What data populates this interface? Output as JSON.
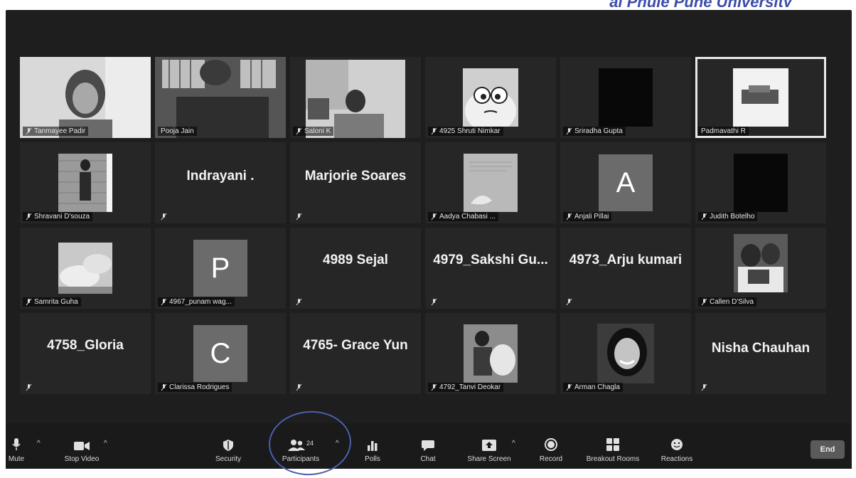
{
  "banner_text": "ai Phule Pune University",
  "participants": [
    {
      "name": "Tanmayee Padir"
    },
    {
      "name": "Pooja Jain"
    },
    {
      "name": "Saloni K"
    },
    {
      "name": "4925 Shruti Nimkar"
    },
    {
      "name": "Sriradha Gupta"
    },
    {
      "name": "Padmavathi R"
    },
    {
      "name": "Shravani D'souza"
    },
    {
      "name": "Indrayani ."
    },
    {
      "name": "Marjorie Soares"
    },
    {
      "name": "Aadya Chabasi ..."
    },
    {
      "name": "Anjali Pillai",
      "initial": "A"
    },
    {
      "name": "Judith Botelho"
    },
    {
      "name": "Samrita Guha"
    },
    {
      "name": "4967_punam wag...",
      "initial": "P"
    },
    {
      "name": "4989 Sejal"
    },
    {
      "name": "4979_Sakshi Gu..."
    },
    {
      "name": "4973_Arju kumari"
    },
    {
      "name": "Callen D'Silva"
    },
    {
      "name": "4758_Gloria"
    },
    {
      "name": "Clarissa Rodrigues",
      "initial": "C"
    },
    {
      "name": "4765- Grace Yun"
    },
    {
      "name": "4792_Tanvi Deokar"
    },
    {
      "name": "Arman Chagla"
    },
    {
      "name": "Nisha Chauhan"
    }
  ],
  "toolbar": {
    "mute": "Mute",
    "stop_video": "Stop Video",
    "security": "Security",
    "participants": "Participants",
    "participants_count": "24",
    "polls": "Polls",
    "chat": "Chat",
    "share_screen": "Share Screen",
    "record": "Record",
    "breakout_rooms": "Breakout Rooms",
    "reactions": "Reactions",
    "end": "End"
  },
  "colors": {
    "screen_bg": "#1e1e1e",
    "tile_bg": "#262626",
    "end_button": "#5a5a5a",
    "annotation": "#4a5fb0"
  }
}
